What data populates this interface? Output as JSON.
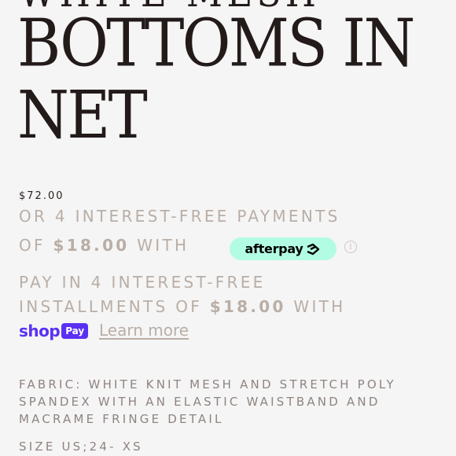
{
  "product": {
    "title_cut_line": "WHITE MESH",
    "title_line_1": "BOTTOMS IN",
    "title_line_2": "NET",
    "price": "$72.00"
  },
  "afterpay": {
    "line_1": "OR 4 INTEREST-FREE PAYMENTS",
    "line_2_prefix": "OF",
    "line_2_amount": "$18.00",
    "line_2_suffix": "WITH",
    "badge_label": "afterpay",
    "badge_color": "#b2fce4",
    "info_icon": "i"
  },
  "shop_pay": {
    "line_1": "PAY IN 4 INTEREST-FREE",
    "line_2_prefix": "INSTALLMENTS OF",
    "line_2_amount": "$18.00",
    "line_2_suffix": "WITH",
    "logo_shop": "shop",
    "logo_pay": "Pay",
    "brand_color": "#5a31f4",
    "learn_more": "Learn more"
  },
  "description": {
    "line_1": "FABRIC: WHITE KNIT MESH AND STRETCH POLY",
    "line_2": "SPANDEX WITH AN ELASTIC WAISTBAND AND",
    "line_3": "MACRAME FRINGE DETAIL",
    "size": "SIZE US;24- XS"
  }
}
